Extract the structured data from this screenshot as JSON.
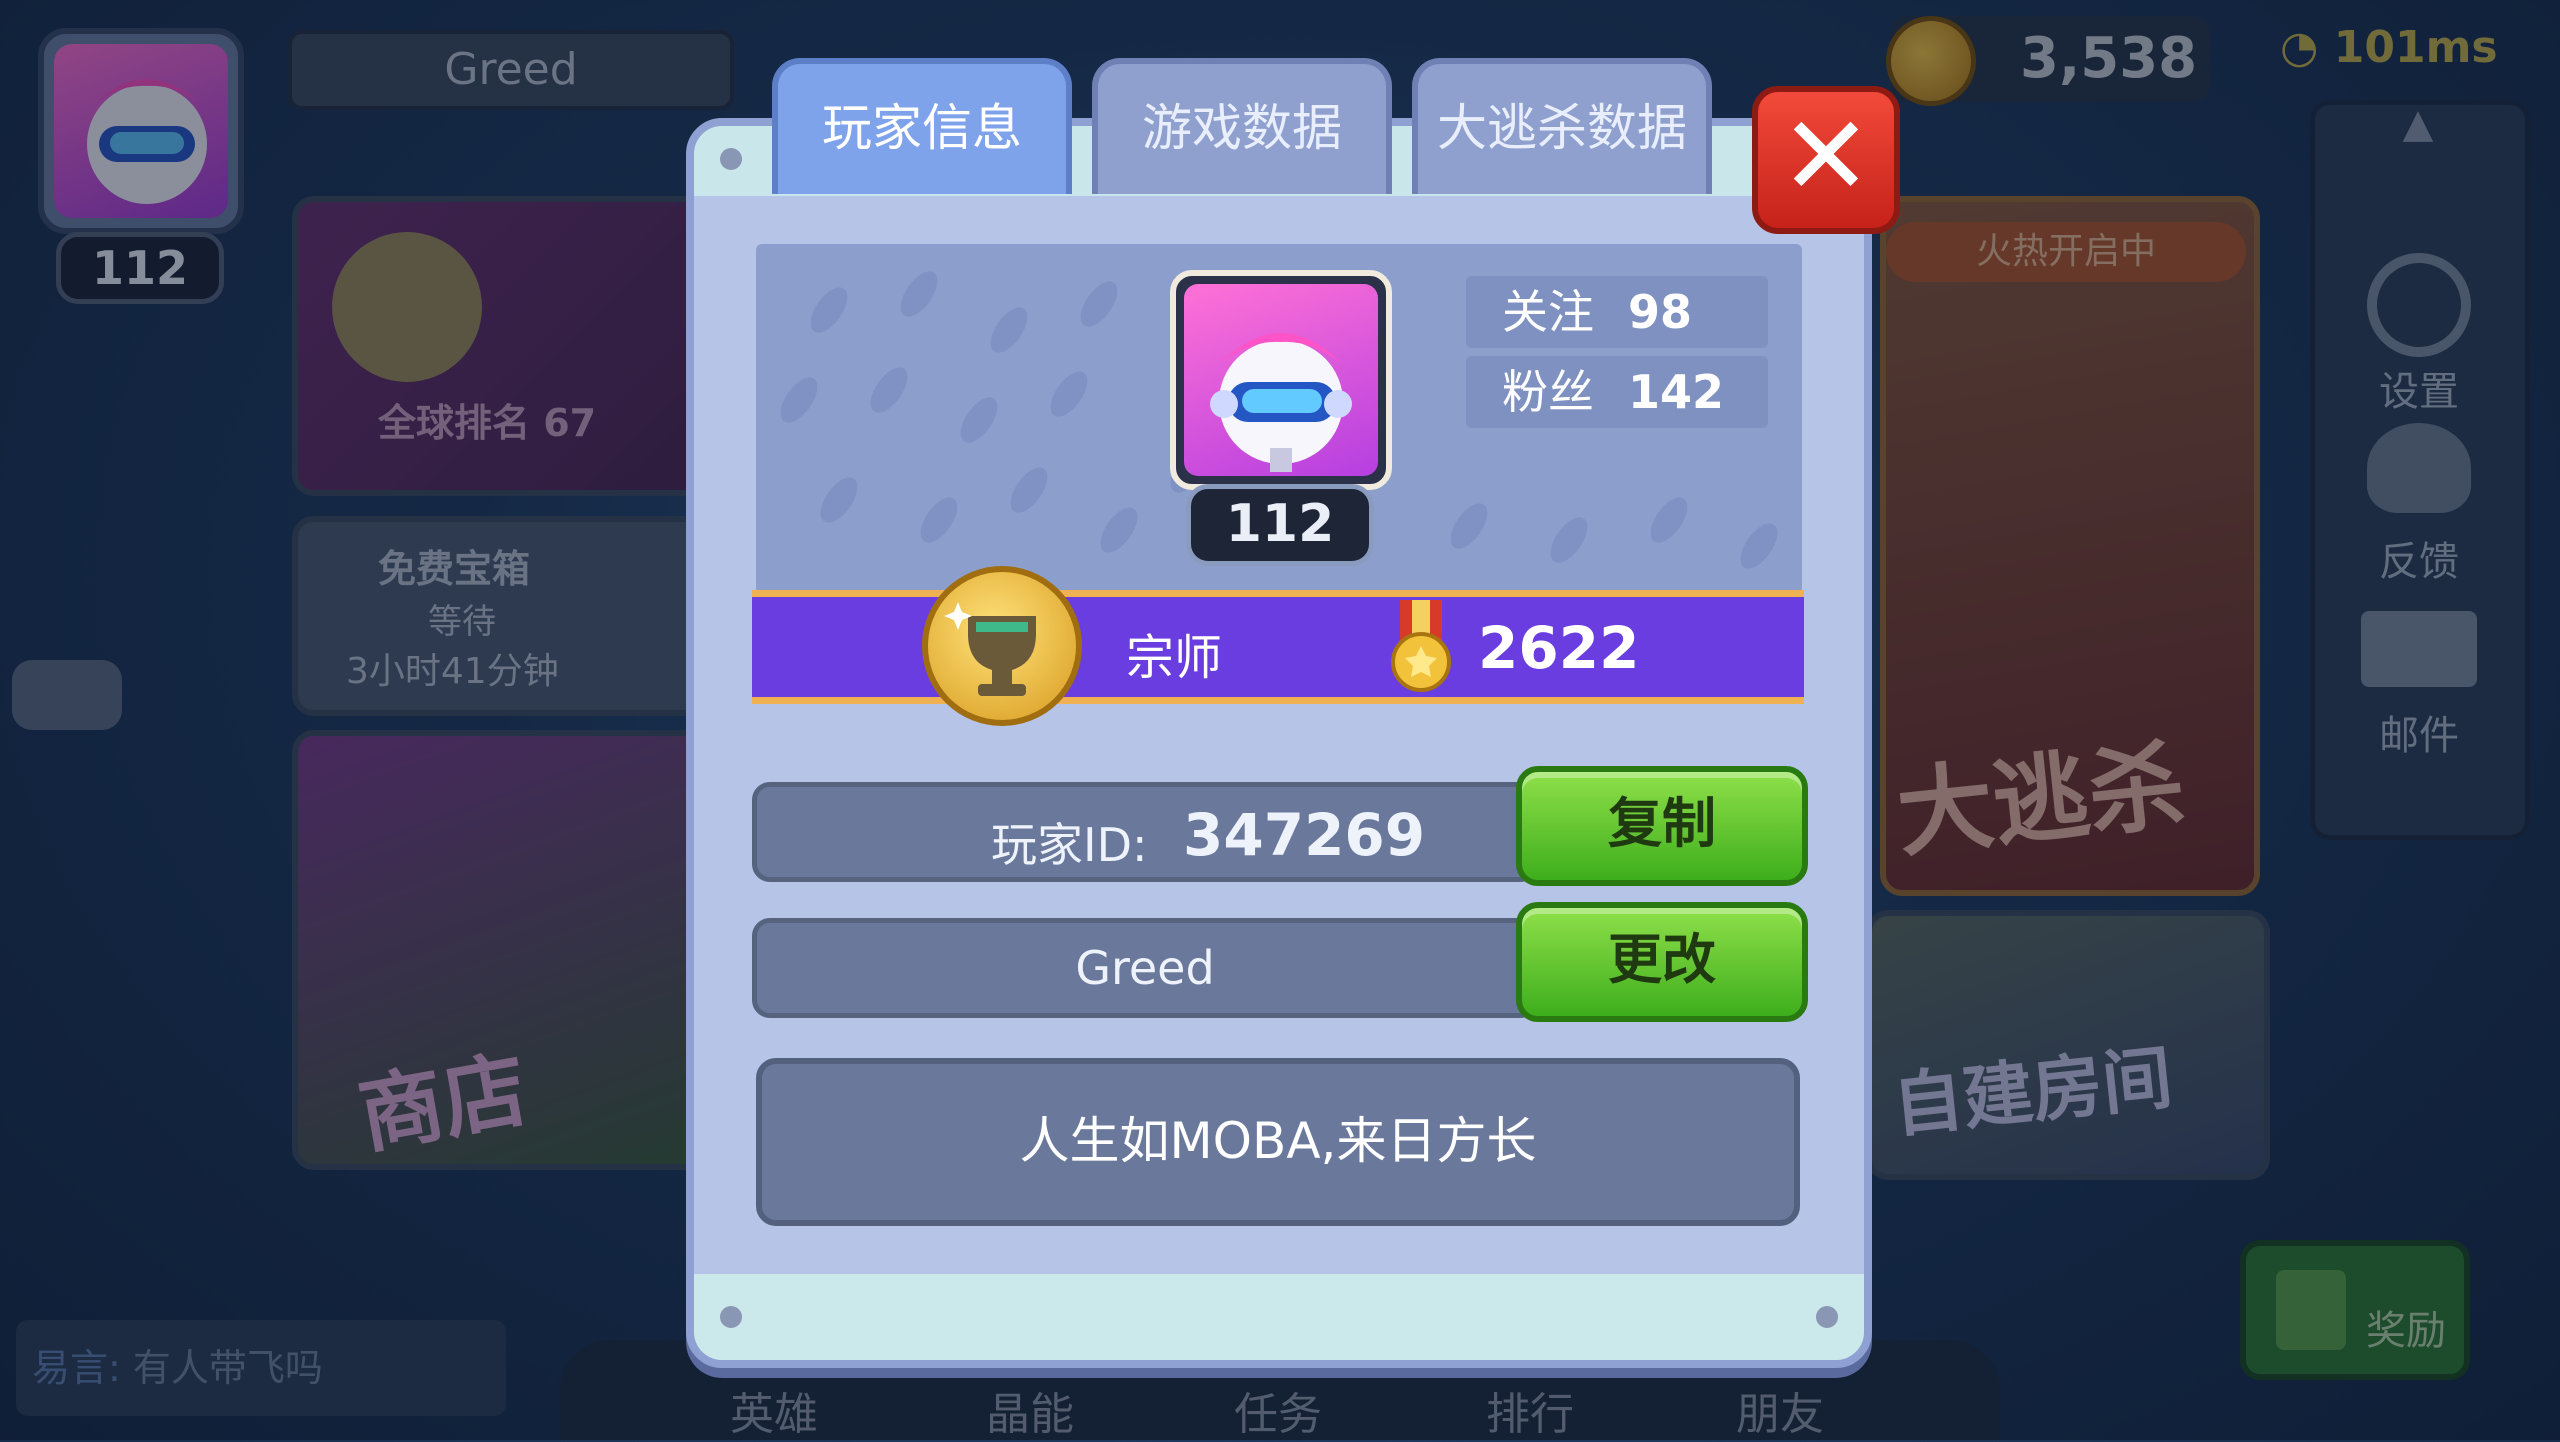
{
  "background": {
    "player_name": "Greed",
    "player_level": "112",
    "coins": "3,538",
    "ping": "101ms",
    "global_rank": "全球排名 67",
    "chest": {
      "title": "免费宝箱",
      "status": "等待",
      "timer": "3小时41分钟"
    },
    "shop_label": "商店",
    "battle_royale_banner": "火热开启中",
    "battle_royale_label": "大逃杀",
    "custom_room_label": "自建房间",
    "side_menu": [
      "设置",
      "反馈",
      "邮件"
    ],
    "bottom_nav": [
      "英雄",
      "晶能",
      "任务",
      "排行",
      "朋友"
    ],
    "chat_prefix": "易言:",
    "chat_placeholder": "有人带飞吗",
    "reward_label": "奖励"
  },
  "modal": {
    "tabs": [
      {
        "label": "玩家信息",
        "active": true
      },
      {
        "label": "游戏数据",
        "active": false
      },
      {
        "label": "大逃杀数据",
        "active": false
      }
    ],
    "close_icon": "close-x",
    "avatar_level": "112",
    "follow_label": "关注",
    "follow_count": "98",
    "fans_label": "粉丝",
    "fans_count": "142",
    "rank_title": "宗师",
    "rank_score": "2622",
    "player_id_label": "玩家ID:",
    "player_id": "347269",
    "copy_label": "复制",
    "name_value": "Greed",
    "change_label": "更改",
    "motto": "人生如MOBA,来日方长"
  },
  "colors": {
    "rank_bar": "#6a3de0",
    "rank_bar_border": "#efb152",
    "active_tab": "#7fa3ea",
    "green_button": "#3eae1c",
    "close_button": "#c6221a"
  }
}
